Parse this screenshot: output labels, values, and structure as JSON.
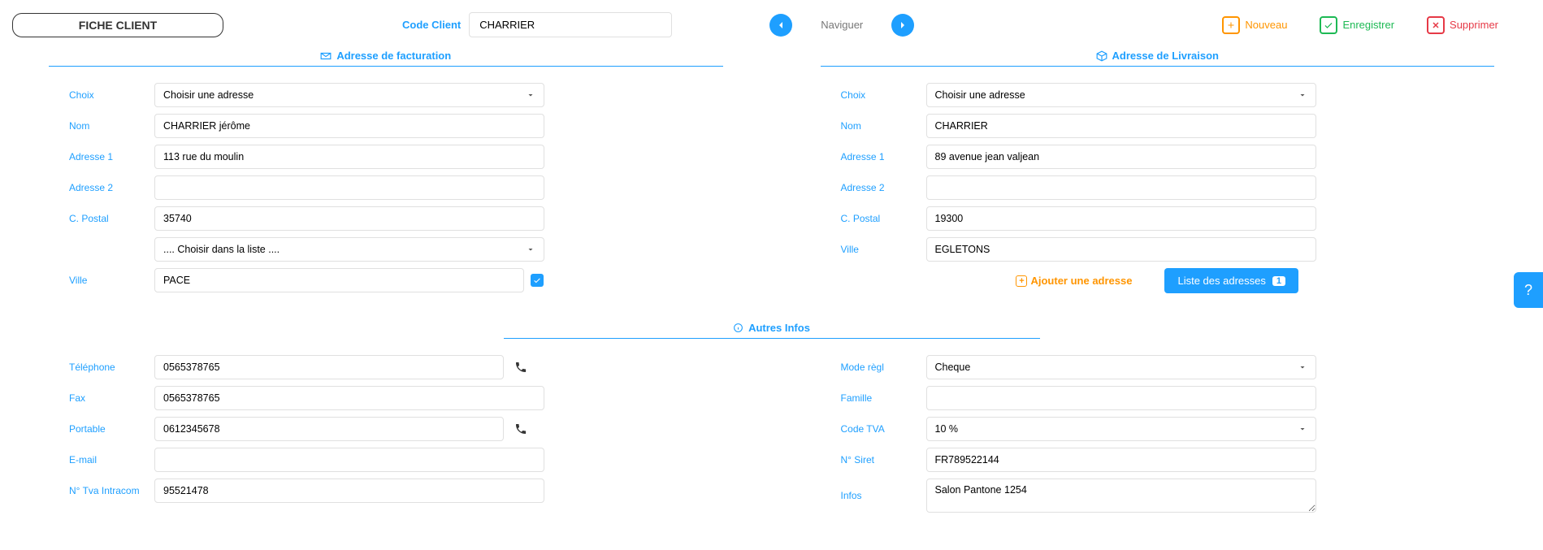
{
  "header": {
    "title": "FICHE CLIENT",
    "code_client_label": "Code Client",
    "code_client_value": "CHARRIER",
    "nav_label": "Naviguer",
    "nouveau_label": "Nouveau",
    "enregistrer_label": "Enregistrer",
    "supprimer_label": "Supprimer"
  },
  "billing": {
    "section_title": "Adresse de facturation",
    "choix_label": "Choix",
    "choix_value": "Choisir une adresse",
    "nom_label": "Nom",
    "nom_value": "CHARRIER jérôme",
    "adr1_label": "Adresse 1",
    "adr1_value": "113 rue du moulin",
    "adr2_label": "Adresse 2",
    "adr2_value": "",
    "cp_label": "C. Postal",
    "cp_value": "35740",
    "liste_placeholder": ".... Choisir dans la liste ....",
    "ville_label": "Ville",
    "ville_value": "PACE"
  },
  "delivery": {
    "section_title": "Adresse de Livraison",
    "choix_label": "Choix",
    "choix_value": "Choisir une adresse",
    "nom_label": "Nom",
    "nom_value": "CHARRIER",
    "adr1_label": "Adresse 1",
    "adr1_value": "89 avenue jean valjean",
    "adr2_label": "Adresse 2",
    "adr2_value": "",
    "cp_label": "C. Postal",
    "cp_value": "19300",
    "ville_label": "Ville",
    "ville_value": "EGLETONS",
    "add_address_label": "Ajouter une adresse",
    "list_address_label": "Liste des adresses",
    "list_count": "1"
  },
  "other": {
    "section_title": "Autres Infos",
    "tel_label": "Téléphone",
    "tel_value": "0565378765",
    "fax_label": "Fax",
    "fax_value": "0565378765",
    "mobile_label": "Portable",
    "mobile_value": "0612345678",
    "email_label": "E-mail",
    "email_value": "",
    "tva_intra_label": "N° Tva Intracom",
    "tva_intra_value": "95521478",
    "mode_regl_label": "Mode règl",
    "mode_regl_value": "Cheque",
    "famille_label": "Famille",
    "famille_value": "",
    "code_tva_label": "Code TVA",
    "code_tva_value": "10 %",
    "siret_label": "N° Siret",
    "siret_value": "FR789522144",
    "infos_label": "Infos",
    "infos_value": "Salon Pantone 1254"
  },
  "help": "?"
}
